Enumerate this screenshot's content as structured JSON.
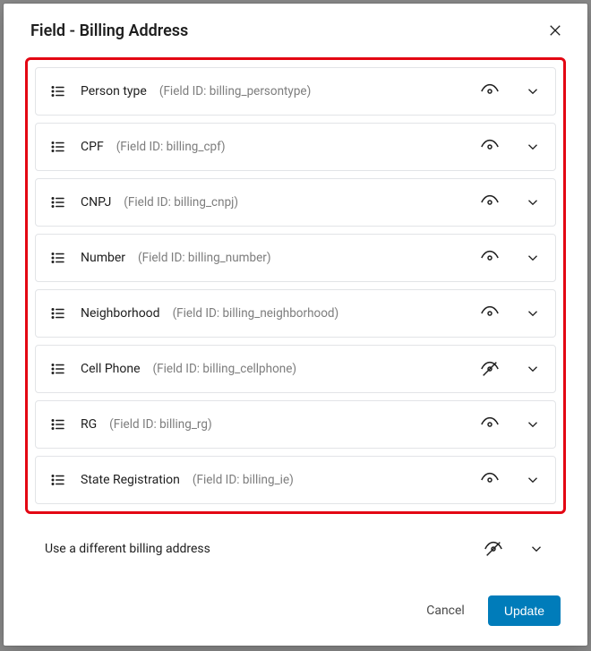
{
  "modal": {
    "title": "Field - Billing Address",
    "fields": [
      {
        "label": "Person type",
        "idtext": "(Field ID: billing_persontype)",
        "visible": true
      },
      {
        "label": "CPF",
        "idtext": "(Field ID: billing_cpf)",
        "visible": true
      },
      {
        "label": "CNPJ",
        "idtext": "(Field ID: billing_cnpj)",
        "visible": true
      },
      {
        "label": "Number",
        "idtext": "(Field ID: billing_number)",
        "visible": true
      },
      {
        "label": "Neighborhood",
        "idtext": "(Field ID: billing_neighborhood)",
        "visible": true
      },
      {
        "label": "Cell Phone",
        "idtext": "(Field ID: billing_cellphone)",
        "visible": false
      },
      {
        "label": "RG",
        "idtext": "(Field ID: billing_rg)",
        "visible": true
      },
      {
        "label": "State Registration",
        "idtext": "(Field ID: billing_ie)",
        "visible": true
      }
    ],
    "extra_row": {
      "label": "Use a different billing address",
      "visible": false
    },
    "buttons": {
      "cancel": "Cancel",
      "update": "Update"
    }
  }
}
